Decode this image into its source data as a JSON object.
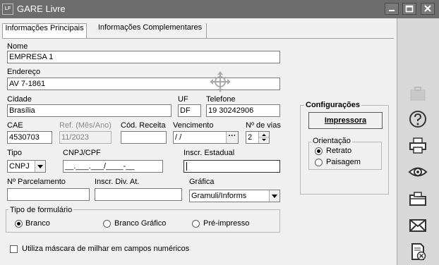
{
  "window": {
    "title": "GARE Livre",
    "icon_text": "LF"
  },
  "tabs": [
    {
      "label": "Informações Principais",
      "active": true
    },
    {
      "label": "Informações Complementares",
      "active": false
    }
  ],
  "fields": {
    "nome": {
      "label": "Nome",
      "value": "EMPRESA 1"
    },
    "endereco": {
      "label": "Endereço",
      "value": "AV 7-1861"
    },
    "cidade": {
      "label": "Cidade",
      "value": "Brasília"
    },
    "uf": {
      "label": "UF",
      "value": "DF"
    },
    "telefone": {
      "label": "Telefone",
      "value": "19 30242906"
    },
    "cae": {
      "label": "CAE",
      "value": "4530703"
    },
    "ref": {
      "label": "Ref. (Mês/Ano)",
      "value": "11/2023"
    },
    "cod_receita": {
      "label": "Cód. Receita",
      "value": ""
    },
    "vencimento": {
      "label": "Vencimento",
      "value": " / /",
      "button": "···"
    },
    "num_vias": {
      "label": "Nº de vias",
      "value": "2"
    },
    "tipo": {
      "label": "Tipo",
      "value": "CNPJ"
    },
    "cnpj_cpf": {
      "label": "CNPJ/CPF",
      "value": "__.___.___/____-__"
    },
    "inscr_estadual": {
      "label": "Inscr. Estadual",
      "value": ""
    },
    "num_parcelamento": {
      "label": "Nº Parcelamento",
      "value": ""
    },
    "inscr_div_at": {
      "label": "Inscr. Div. At.",
      "value": ""
    },
    "grafica": {
      "label": "Gráfica",
      "value": "Gramuli/Informs"
    }
  },
  "tipo_formulario": {
    "label": "Tipo de formulário",
    "options": [
      {
        "label": "Branco",
        "selected": true
      },
      {
        "label": "Branco Gráfico",
        "selected": false
      },
      {
        "label": "Pré-impresso",
        "selected": false
      }
    ]
  },
  "mascara_checkbox": {
    "label": "Utiliza máscara de milhar em campos numéricos",
    "checked": false
  },
  "configuracoes": {
    "label": "Configurações",
    "impressora_button": "Impressora",
    "orientacao": {
      "label": "Orientação",
      "options": [
        {
          "label": "Retrato",
          "selected": true
        },
        {
          "label": "Paisagem",
          "selected": false
        }
      ]
    }
  },
  "toolbar_icons": [
    "briefcase-icon",
    "help-icon",
    "printer-icon",
    "preview-eye-icon",
    "folder-icon",
    "envelope-icon",
    "document-delete-icon"
  ]
}
